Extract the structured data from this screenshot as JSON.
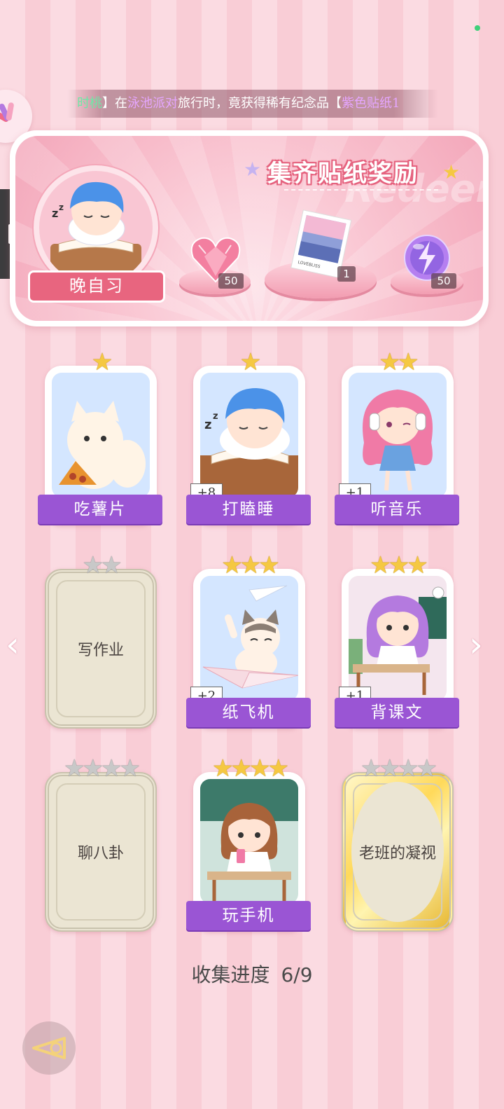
{
  "ticker": {
    "bracket_open": "时桃",
    "text_1": "】在",
    "place": "泳池派对",
    "text_2": "旅行时，竟获得稀有纪念品【",
    "item": "紫色贴纸1"
  },
  "reward_banner": {
    "title": "集齐贴纸奖励",
    "subtitle_watermark": "Redeem",
    "badge_label": "晚自习",
    "rewards": [
      {
        "name": "pink-heart-gem",
        "count": "50"
      },
      {
        "name": "postcard",
        "count": "1"
      },
      {
        "name": "purple-energy-orb",
        "count": "50"
      }
    ]
  },
  "stickers": [
    {
      "name": "吃薯片",
      "stars": 1,
      "collected": true,
      "plus": ""
    },
    {
      "name": "打瞌睡",
      "stars": 1,
      "collected": true,
      "plus": "+8"
    },
    {
      "name": "听音乐",
      "stars": 2,
      "collected": true,
      "plus": "+1"
    },
    {
      "name": "写作业",
      "stars": 2,
      "collected": false,
      "plus": ""
    },
    {
      "name": "纸飞机",
      "stars": 3,
      "collected": true,
      "plus": "+2"
    },
    {
      "name": "背课文",
      "stars": 3,
      "collected": true,
      "plus": "+1"
    },
    {
      "name": "聊八卦",
      "stars": 4,
      "collected": false,
      "plus": ""
    },
    {
      "name": "玩手机",
      "stars": 4,
      "collected": true,
      "plus": ""
    },
    {
      "name": "老班的凝视",
      "stars": 4,
      "collected": false,
      "plus": ""
    }
  ],
  "progress": {
    "label": "收集进度",
    "value": "6/9"
  },
  "colors": {
    "label_purple": "#9a55d4",
    "banner_pink": "#f3a7ba",
    "star_gold": "#f5c842"
  }
}
